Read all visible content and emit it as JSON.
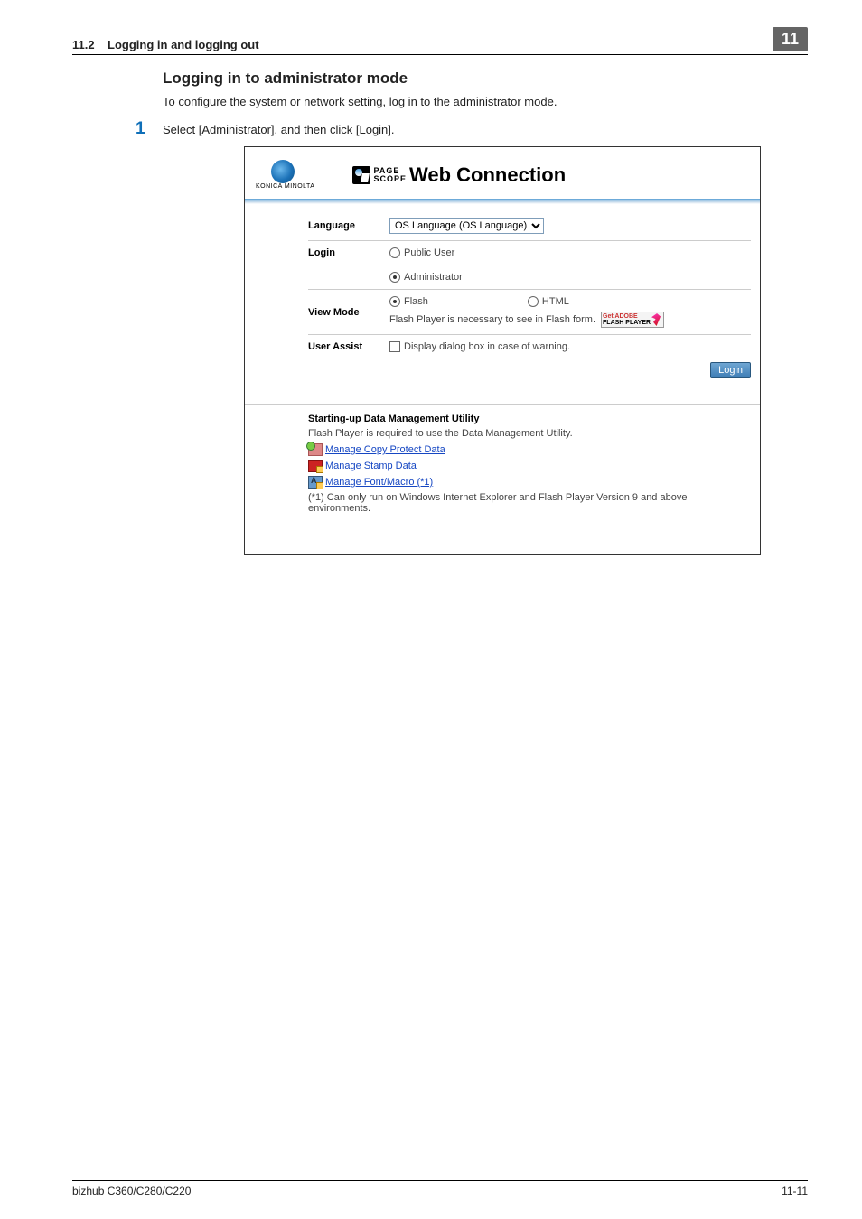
{
  "header": {
    "section_num": "11.2",
    "section_title": "Logging in and logging out",
    "chapter_tab": "11"
  },
  "h2": "Logging in to administrator mode",
  "intro": "To configure the system or network setting, log in to the administrator mode.",
  "step": {
    "num": "1",
    "text": "Select [Administrator], and then click [Login]."
  },
  "screenshot": {
    "brand_small": "KONICA MINOLTA",
    "ps_line1": "PAGE",
    "ps_line2": "SCOPE",
    "ps_title": "Web Connection",
    "labels": {
      "language": "Language",
      "login": "Login",
      "viewmode": "View Mode",
      "userassist": "User Assist"
    },
    "language_value": "OS Language (OS Language)",
    "login_public": "Public User",
    "login_admin": "Administrator",
    "viewmode_flash": "Flash",
    "viewmode_html": "HTML",
    "viewmode_hint": "Flash Player is necessary to see in Flash form.",
    "flash_badge_1": "Get ADOBE",
    "flash_badge_2": "FLASH PLAYER",
    "userassist_check": "Display dialog box in case of warning.",
    "login_button": "Login",
    "dmu": {
      "title": "Starting-up Data Management Utility",
      "subtitle": "Flash Player is required to use the Data Management Utility.",
      "link1": "Manage Copy Protect Data",
      "link2": "Manage Stamp Data",
      "link3": "Manage Font/Macro (*1)",
      "note": "(*1) Can only run on Windows Internet Explorer and Flash Player Version 9 and above environments."
    }
  },
  "footer": {
    "left": "bizhub C360/C280/C220",
    "right": "11-11"
  }
}
